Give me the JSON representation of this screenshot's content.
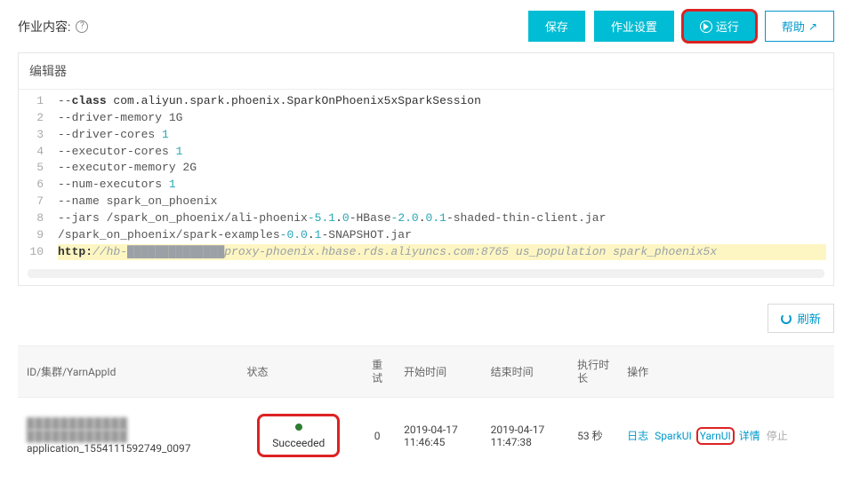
{
  "header": {
    "title": "作业内容:",
    "buttons": {
      "save": "保存",
      "settings": "作业设置",
      "run": "运行",
      "help": "帮助"
    }
  },
  "editor": {
    "title": "编辑器",
    "lines": [
      {
        "n": "1",
        "segs": [
          {
            "t": "--",
            "c": "tok-key"
          },
          {
            "t": "class",
            "c": "tok-bold"
          },
          {
            "t": " com.aliyun.spark.phoenix.SparkOnPhoenix5xSparkSession",
            "c": ""
          }
        ]
      },
      {
        "n": "2",
        "segs": [
          {
            "t": "--driver-memory 1G",
            "c": "tok-key"
          }
        ]
      },
      {
        "n": "3",
        "segs": [
          {
            "t": "--driver-cores ",
            "c": "tok-key"
          },
          {
            "t": "1",
            "c": "tok-num"
          }
        ]
      },
      {
        "n": "4",
        "segs": [
          {
            "t": "--executor-cores ",
            "c": "tok-key"
          },
          {
            "t": "1",
            "c": "tok-num"
          }
        ]
      },
      {
        "n": "5",
        "segs": [
          {
            "t": "--executor-memory 2G",
            "c": "tok-key"
          }
        ]
      },
      {
        "n": "6",
        "segs": [
          {
            "t": "--num-executors ",
            "c": "tok-key"
          },
          {
            "t": "1",
            "c": "tok-num"
          }
        ]
      },
      {
        "n": "7",
        "segs": [
          {
            "t": "--name spark_on_phoenix",
            "c": "tok-key"
          }
        ]
      },
      {
        "n": "8",
        "segs": [
          {
            "t": "--jars /spark_on_phoenix/ali-phoenix",
            "c": "tok-key"
          },
          {
            "t": "-5.1",
            "c": "tok-num"
          },
          {
            "t": ".",
            "c": ""
          },
          {
            "t": "0",
            "c": "tok-num"
          },
          {
            "t": "-HBase",
            "c": "tok-key"
          },
          {
            "t": "-2.0",
            "c": "tok-num"
          },
          {
            "t": ".",
            "c": ""
          },
          {
            "t": "0.1",
            "c": "tok-num"
          },
          {
            "t": "-shaded-thin-client.jar",
            "c": "tok-key"
          }
        ]
      },
      {
        "n": "9",
        "segs": [
          {
            "t": "/spark_on_phoenix/spark-examples",
            "c": "tok-key"
          },
          {
            "t": "-0.0",
            "c": "tok-num"
          },
          {
            "t": ".",
            "c": ""
          },
          {
            "t": "1",
            "c": "tok-num"
          },
          {
            "t": "-SNAPSHOT.jar",
            "c": "tok-key"
          }
        ]
      },
      {
        "n": "10",
        "hl": true,
        "segs": [
          {
            "t": "http:",
            "c": "tok-bold"
          },
          {
            "t": "//hb-",
            "c": "tok-comment"
          },
          {
            "t": "██████████████",
            "c": "tok-comment"
          },
          {
            "t": "proxy-phoenix.hbase.rds.aliyuncs.com:8765 us_population spark_phoenix5x",
            "c": "tok-comment"
          }
        ]
      }
    ]
  },
  "refresh_label": "刷新",
  "table": {
    "headers": {
      "id": "ID/集群/YarnAppId",
      "status": "状态",
      "retry": "重试",
      "start": "开始时间",
      "end": "结束时间",
      "duration": "执行时长",
      "ops": "操作"
    },
    "row": {
      "cluster_masked": "████████████",
      "app_id": "application_1554111592749_0097",
      "status": "Succeeded",
      "retry": "0",
      "start": "2019-04-17 11:46:45",
      "end": "2019-04-17 11:47:38",
      "duration": "53 秒",
      "ops": {
        "log": "日志",
        "sparkui": "SparkUI",
        "yarnui": "YarnUI",
        "detail": "详情",
        "stop": "停止"
      }
    }
  }
}
